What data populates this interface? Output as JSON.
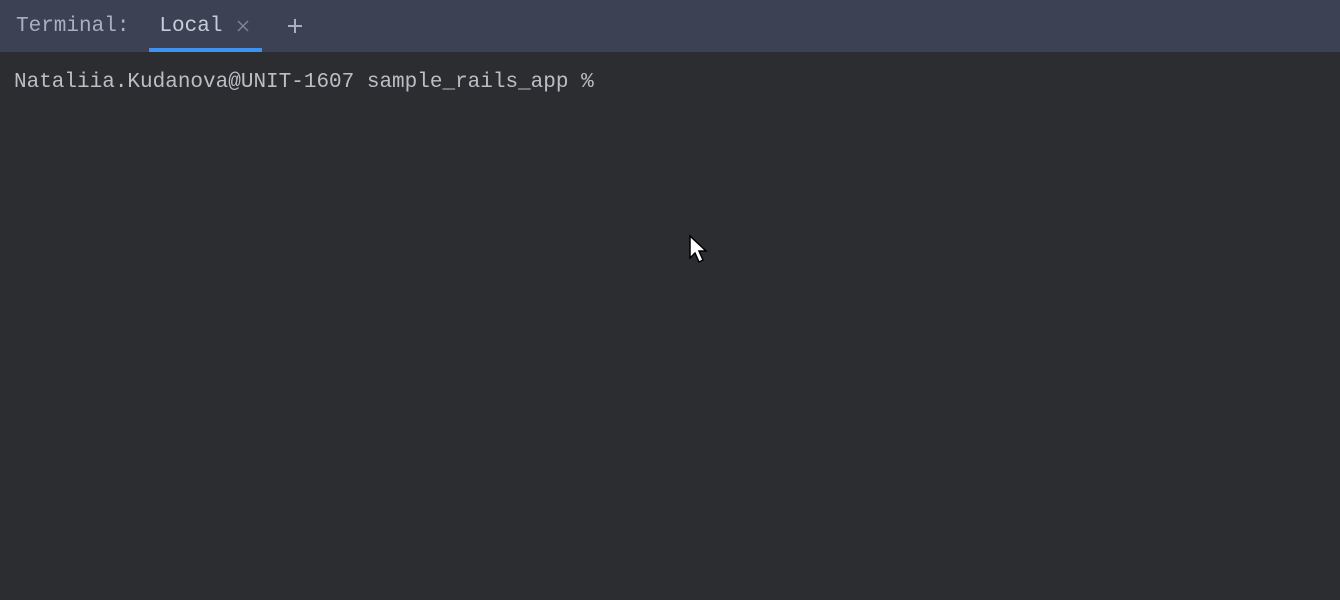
{
  "header": {
    "panel_title": "Terminal:",
    "tabs": [
      {
        "label": "Local",
        "active": true
      }
    ]
  },
  "terminal": {
    "prompt": "Nataliia.Kudanova@UNIT-1607 sample_rails_app % "
  }
}
